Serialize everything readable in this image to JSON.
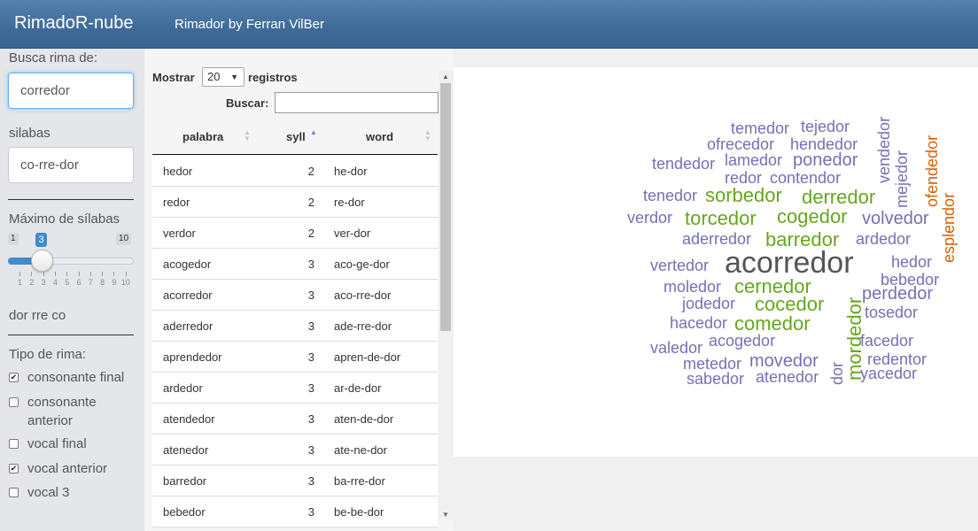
{
  "navbar": {
    "brand": "RimadoR-nube",
    "title": "Rimador by Ferran VilBer"
  },
  "sidebar": {
    "search_label": "Busca rima de:",
    "search_value": "corredor",
    "syllables_label": "silabas",
    "syllables_value": "co-rre-dor",
    "max_syllables_label": "Máximo de sílabas",
    "slider": {
      "min": "1",
      "max": "10",
      "value": "3",
      "value_fraction": 0.222,
      "ticks": [
        "1",
        "2",
        "3",
        "4",
        "5",
        "6",
        "7",
        "8",
        "9",
        "10"
      ]
    },
    "rhyme_parts": "dor rre co",
    "rhyme_type_label": "Tipo de rima:",
    "options": [
      {
        "label": "consonante final",
        "checked": true
      },
      {
        "label": "consonante anterior",
        "checked": false
      },
      {
        "label": "vocal final",
        "checked": false
      },
      {
        "label": "vocal anterior",
        "checked": true
      },
      {
        "label": "vocal 3",
        "checked": false
      }
    ]
  },
  "table": {
    "show_label": "Mostrar",
    "page_size": "20",
    "records_label": "registros",
    "search_label": "Buscar:",
    "search_value": "",
    "columns": [
      "palabra",
      "syll",
      "word"
    ],
    "sorted_column": "syll",
    "rows": [
      [
        "hedor",
        "2",
        "he-dor"
      ],
      [
        "redor",
        "2",
        "re-dor"
      ],
      [
        "verdor",
        "2",
        "ver-dor"
      ],
      [
        "acogedor",
        "3",
        "aco-ge-dor"
      ],
      [
        "acorredor",
        "3",
        "aco-rre-dor"
      ],
      [
        "aderredor",
        "3",
        "ade-rre-dor"
      ],
      [
        "aprendedor",
        "3",
        "apren-de-dor"
      ],
      [
        "ardedor",
        "3",
        "ar-de-dor"
      ],
      [
        "atendedor",
        "3",
        "aten-de-dor"
      ],
      [
        "atenedor",
        "3",
        "ate-ne-dor"
      ],
      [
        "barredor",
        "3",
        "ba-rre-dor"
      ],
      [
        "bebedor",
        "3",
        "be-be-dor"
      ]
    ]
  },
  "cloud": {
    "colors": {
      "purple": "#7570b3",
      "green": "#66a61e",
      "orange": "#d95f02",
      "gray": "#555555"
    },
    "words": [
      "temedor",
      "tejedor",
      "ofrecedor",
      "hendedor",
      "tendedor",
      "lamedor",
      "ponedor",
      "redor",
      "contendor",
      "vendedor",
      "mejedor",
      "ofendedor",
      "tenedor",
      "sorbedor",
      "derredor",
      "esplendor",
      "verdor",
      "torcedor",
      "cogedor",
      "volvedor",
      "aderredor",
      "barredor",
      "ardedor",
      "vertedor",
      "acorredor",
      "hedor",
      "bebedor",
      "moledor",
      "cernedor",
      "perdedor",
      "jodedor",
      "cocedor",
      "mordedor",
      "hacedor",
      "comedor",
      "tosedor",
      "acogedor",
      "valedor",
      "facedor",
      "metedor",
      "movedor",
      "dor",
      "redentor",
      "sabedor",
      "atenedor",
      "yacedor"
    ]
  }
}
